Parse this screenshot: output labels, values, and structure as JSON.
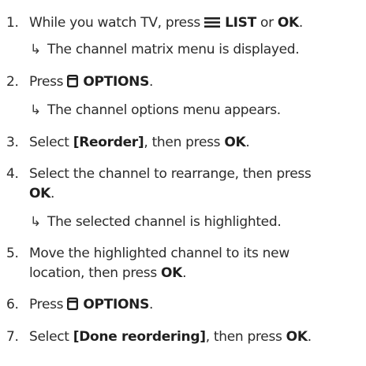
{
  "steps": [
    {
      "num": "1.",
      "pre": "While you watch TV, press ",
      "b1": "LIST",
      "mid": " or ",
      "b2": "OK",
      "post": ".",
      "result": "The channel matrix menu is displayed."
    },
    {
      "num": "2.",
      "pre": "Press ",
      "b1": "OPTIONS",
      "post": ".",
      "result": "The channel options menu appears."
    },
    {
      "num": "3.",
      "pre": "Select ",
      "b1": "[Reorder]",
      "mid": ", then press ",
      "b2": "OK",
      "post": "."
    },
    {
      "num": "4.",
      "line1": "Select the channel to rearrange, then press",
      "b1": "OK",
      "post": ".",
      "result": "The selected channel is highlighted."
    },
    {
      "num": "5.",
      "line1": "Move the highlighted channel to its new",
      "line2": "location, then press ",
      "b1": "OK",
      "post": "."
    },
    {
      "num": "6.",
      "pre": "Press ",
      "b1": "OPTIONS",
      "post": "."
    },
    {
      "num": "7.",
      "pre": "Select ",
      "b1": "[Done reordering]",
      "mid": ", then press ",
      "b2": "OK",
      "post": "."
    }
  ],
  "result_arrow": "↳",
  "icons": {
    "list": "list-icon",
    "options": "options-icon"
  }
}
